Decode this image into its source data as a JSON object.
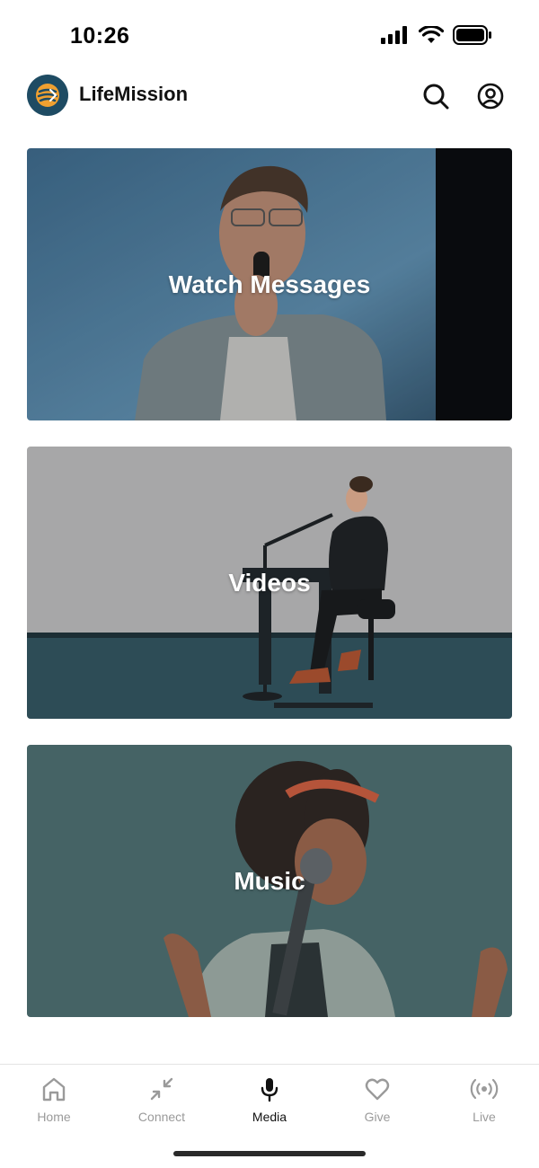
{
  "status_bar": {
    "time": "10:26"
  },
  "header": {
    "app_name": "LifeMission",
    "search_icon": "search-icon",
    "account_icon": "account-icon"
  },
  "cards": [
    {
      "label": "Watch Messages"
    },
    {
      "label": "Videos"
    },
    {
      "label": "Music"
    }
  ],
  "tab_bar": {
    "items": [
      {
        "label": "Home",
        "icon": "home-icon",
        "active": false
      },
      {
        "label": "Connect",
        "icon": "connect-icon",
        "active": false
      },
      {
        "label": "Media",
        "icon": "microphone-icon",
        "active": true
      },
      {
        "label": "Give",
        "icon": "heart-icon",
        "active": false
      },
      {
        "label": "Live",
        "icon": "broadcast-icon",
        "active": false
      }
    ]
  },
  "colors": {
    "accent": "#f0a030",
    "logo_bg": "#1e4b63",
    "tab_active": "#111111",
    "tab_inactive": "#9a9a9a"
  }
}
